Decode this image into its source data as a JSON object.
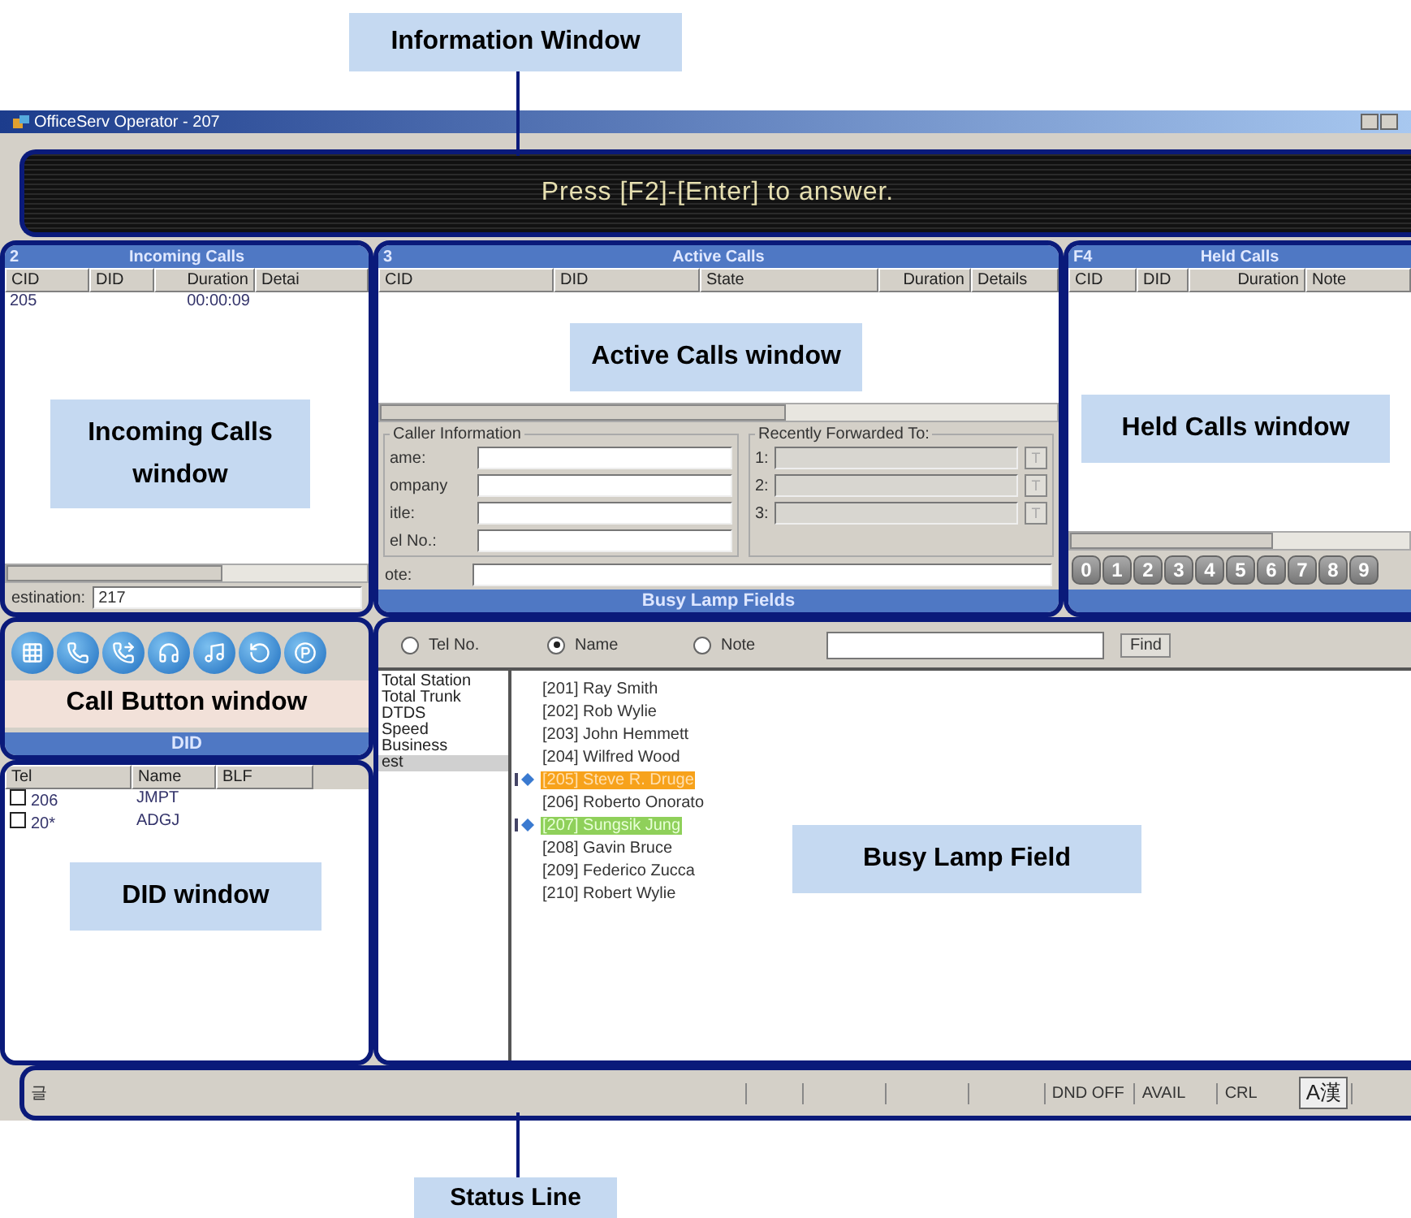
{
  "callouts": {
    "information": "Information Window",
    "status": "Status Line"
  },
  "window": {
    "title": "OfficeServ Operator - 207"
  },
  "info_message": "Press [F2]-[Enter] to answer.",
  "incoming": {
    "hotkey": "2",
    "title": "Incoming Calls",
    "columns": [
      "CID",
      "DID",
      "Duration",
      "Detai"
    ],
    "rows": [
      {
        "cid": "205",
        "duration": "00:00:09"
      }
    ],
    "destination_label": "estination:",
    "destination_value": "217",
    "callout": "Incoming Calls window"
  },
  "active": {
    "hotkey": "3",
    "title": "Active Calls",
    "columns": [
      "CID",
      "DID",
      "State",
      "Duration",
      "Details"
    ],
    "callout": "Active Calls window",
    "caller_info": {
      "legend": "Caller Information",
      "fields": [
        "ame:",
        "ompany",
        "itle:",
        "el No.:"
      ],
      "note_label": "ote:"
    },
    "forwarded": {
      "legend": "Recently Forwarded To:",
      "slots": [
        {
          "label": "1:",
          "button": "T"
        },
        {
          "label": "2:",
          "button": "T"
        },
        {
          "label": "3:",
          "button": "T"
        }
      ]
    },
    "footer": "Busy Lamp Fields"
  },
  "held": {
    "hotkey": "F4",
    "title": "Held Calls",
    "columns": [
      "CID",
      "DID",
      "Duration",
      "Note"
    ],
    "callout": "Held Calls window",
    "digits": [
      "0",
      "1",
      "2",
      "3",
      "4",
      "5",
      "6",
      "7",
      "8",
      "9"
    ]
  },
  "call_buttons": {
    "callout": "Call Button window",
    "footer": "DID"
  },
  "did": {
    "columns": [
      "Tel",
      "Name",
      "BLF"
    ],
    "rows": [
      {
        "tel": "206",
        "name": "JMPT",
        "checked": false
      },
      {
        "tel": "20*",
        "name": "ADGJ",
        "checked": false
      }
    ],
    "callout": "DID window"
  },
  "blf": {
    "search_options": [
      {
        "label": "Tel No.",
        "selected": false
      },
      {
        "label": "Name",
        "selected": true
      },
      {
        "label": "Note",
        "selected": false
      }
    ],
    "find": "Find",
    "groups": [
      {
        "label": "Total Station",
        "selected": false
      },
      {
        "label": "Total Trunk",
        "selected": false
      },
      {
        "label": "DTDS",
        "selected": false
      },
      {
        "label": "Speed",
        "selected": false
      },
      {
        "label": "Business",
        "selected": false
      },
      {
        "label": "est",
        "selected": true
      }
    ],
    "entries": [
      {
        "label": "[201] Ray Smith",
        "kind": "idle"
      },
      {
        "label": "[202] Rob Wylie",
        "kind": "idle"
      },
      {
        "label": "[203] John Hemmett",
        "kind": "idle"
      },
      {
        "label": "[204] Wilfred Wood",
        "kind": "idle"
      },
      {
        "label": "[205] Steve R. Druge",
        "kind": "ringing"
      },
      {
        "label": "[206] Roberto Onorato",
        "kind": "idle"
      },
      {
        "label": "[207] Sungsik Jung",
        "kind": "busy"
      },
      {
        "label": "[208] Gavin Bruce",
        "kind": "idle"
      },
      {
        "label": "[209] Federico Zucca",
        "kind": "idle"
      },
      {
        "label": "[210] Robert Wylie",
        "kind": "idle"
      }
    ],
    "callout": "Busy Lamp Field"
  },
  "status_bar": {
    "left": "글",
    "items": [
      "DND OFF",
      "AVAIL",
      "CRL"
    ],
    "ime": "A漢"
  }
}
